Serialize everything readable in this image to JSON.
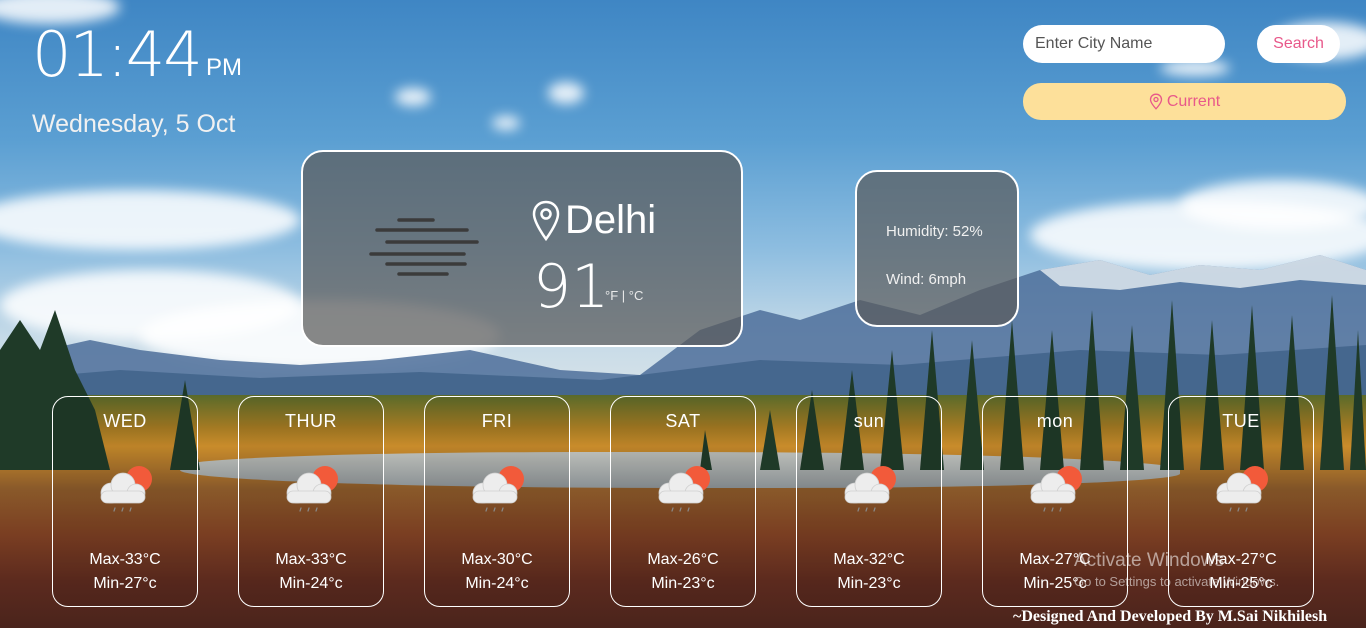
{
  "clock": {
    "time": "01:44",
    "ampm": "PM",
    "date": "Wednesday, 5 Oct"
  },
  "search": {
    "placeholder": "Enter City Name",
    "button_label": "Search",
    "current_label": "Current"
  },
  "weather": {
    "city": "Delhi",
    "temperature": "91",
    "units": "°F | °C",
    "humidity": "Humidity: 52%",
    "wind": "Wind: 6mph",
    "icon": "haze-icon"
  },
  "forecast": [
    {
      "day": "WED",
      "max": "Max-33°C",
      "min": "Min-27°c",
      "icon": "partly-cloudy-icon"
    },
    {
      "day": "THUR",
      "max": "Max-33°C",
      "min": "Min-24°c",
      "icon": "partly-cloudy-icon"
    },
    {
      "day": "FRI",
      "max": "Max-30°C",
      "min": "Min-24°c",
      "icon": "partly-cloudy-icon"
    },
    {
      "day": "SAT",
      "max": "Max-26°C",
      "min": "Min-23°c",
      "icon": "partly-cloudy-icon"
    },
    {
      "day": "sun",
      "max": "Max-32°C",
      "min": "Min-23°c",
      "icon": "partly-cloudy-icon"
    },
    {
      "day": "mon",
      "max": "Max-27°C",
      "min": "Min-25°c",
      "icon": "partly-cloudy-icon"
    },
    {
      "day": "TUE",
      "max": "Max-27°C",
      "min": "Min-25°c",
      "icon": "partly-cloudy-icon"
    }
  ],
  "watermark": {
    "title": "Activate Windows",
    "subtitle": "Go to Settings to activate Windows."
  },
  "footer": "~Designed And Developed By M.Sai Nikhilesh",
  "colors": {
    "accent": "#e8588a",
    "current_button": "#fde09a",
    "card_bg": "#5a5a5a"
  }
}
